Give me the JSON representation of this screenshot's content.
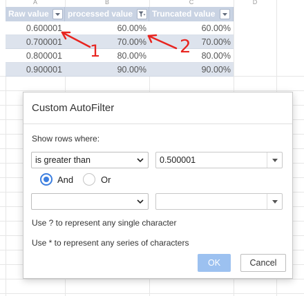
{
  "sheet": {
    "column_letters": [
      "A",
      "B",
      "C",
      "D"
    ],
    "headers": [
      {
        "label": "Raw value",
        "filter_icon": "dropdown-arrow-icon"
      },
      {
        "label": "processed value",
        "filter_icon": "filter-active-icon"
      },
      {
        "label": "Truncated value",
        "filter_icon": "dropdown-arrow-icon"
      }
    ],
    "rows": [
      [
        "0.600001",
        "60.00%",
        "60.00%"
      ],
      [
        "0.700001",
        "70.00%",
        "70.00%"
      ],
      [
        "0.800001",
        "80.00%",
        "80.00%"
      ],
      [
        "0.900001",
        "90.00%",
        "90.00%"
      ]
    ],
    "annotations": [
      "1",
      "2"
    ],
    "colors": {
      "header_bg": "#c9d3e3",
      "band_bg": "#dde3ed",
      "annotation": "#e8241f"
    }
  },
  "dialog": {
    "title": "Custom AutoFilter",
    "show_rows_label": "Show rows where:",
    "condition1": {
      "operator": "is greater than",
      "value": "0.500001"
    },
    "logic": {
      "and_label": "And",
      "or_label": "Or",
      "selected": "And"
    },
    "condition2": {
      "operator": "",
      "value": ""
    },
    "hint_single": "Use ? to represent any single character",
    "hint_series": "Use * to represent any series of characters",
    "ok_label": "OK",
    "cancel_label": "Cancel",
    "colors": {
      "accent": "#3d7fe0",
      "ok_bg": "#9cc1f0"
    }
  }
}
